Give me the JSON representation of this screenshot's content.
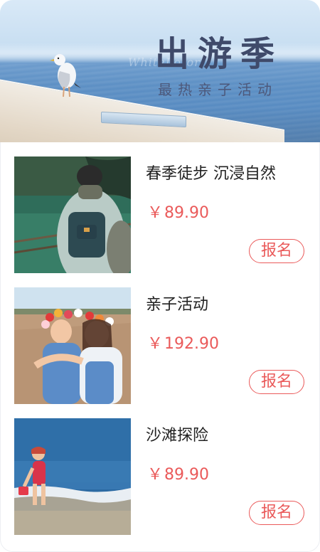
{
  "banner": {
    "title": "出游季",
    "subtitle": "最热亲子活动",
    "watermark": "WhiteLotor"
  },
  "activities": [
    {
      "title": "春季徒步 沉浸自然",
      "currency": "￥",
      "price": "89.90",
      "button_label": "报名",
      "photo": "hiker-with-backpack-by-lake"
    },
    {
      "title": "亲子活动",
      "currency": "￥",
      "price": "192.90",
      "button_label": "报名",
      "photo": "mother-and-child-with-flower-crowns"
    },
    {
      "title": "沙滩探险",
      "currency": "￥",
      "price": "89.90",
      "button_label": "报名",
      "photo": "child-playing-on-beach"
    }
  ],
  "colors": {
    "accent": "#ea5a5a",
    "title_text": "#3f4a6a",
    "body_text": "#222222"
  }
}
